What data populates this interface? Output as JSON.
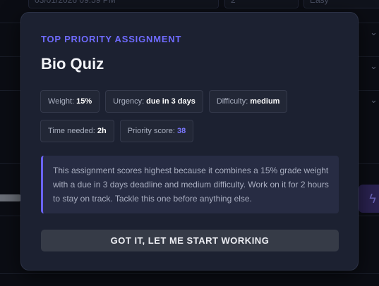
{
  "background": {
    "datetime_field": "03/01/2026 09:59 PM",
    "hours_field": "2",
    "difficulty_field": "Easy",
    "chevron_icon": "chevron-down-icon",
    "action_icon": "lightning-icon"
  },
  "modal": {
    "kicker": "TOP PRIORITY ASSIGNMENT",
    "title": "Bio Quiz",
    "chips": {
      "weight_label": "Weight:",
      "weight_value": "15%",
      "urgency_label": "Urgency:",
      "urgency_value": "due in 3 days",
      "difficulty_label": "Difficulty:",
      "difficulty_value": "medium",
      "time_label": "Time needed:",
      "time_value": "2h",
      "score_label": "Priority score:",
      "score_value": "38"
    },
    "explanation": "This assignment scores highest because it combines a 15% grade weight with a due in 3 days deadline and medium difficulty. Work on it for 2 hours to stay on track. Tackle this one before anything else.",
    "cta_label": "GOT IT, LET ME START WORKING"
  },
  "colors": {
    "accent": "#6f6bff",
    "modal_bg": "#1c2131",
    "page_bg": "#0b0d14"
  }
}
